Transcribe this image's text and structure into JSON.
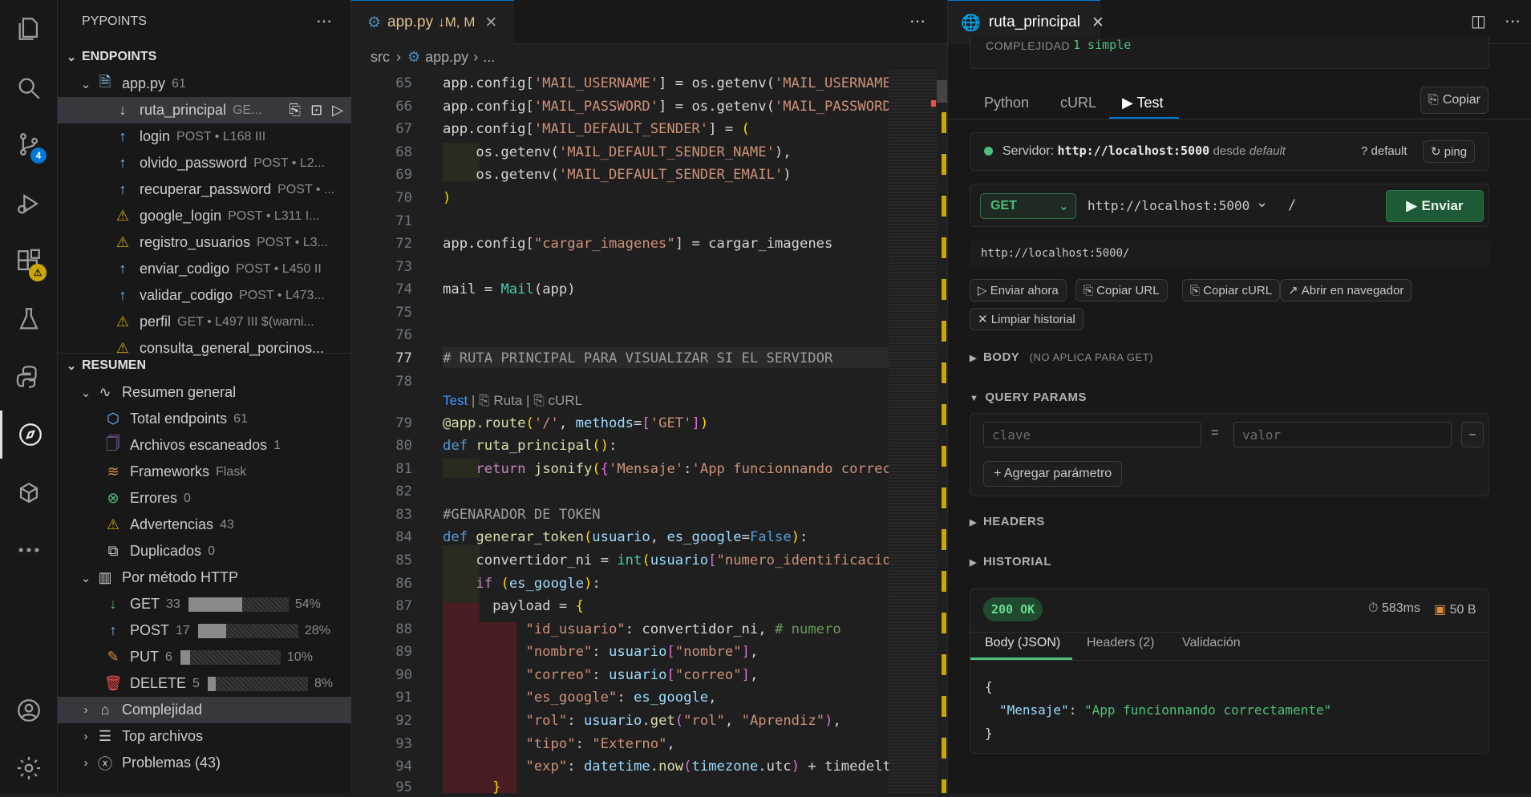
{
  "activity": {
    "scm_badge": "4",
    "warn_badge": "⚠"
  },
  "sidebar": {
    "title": "PYPOINTS",
    "endpoints_header": "ENDPOINTS",
    "file": {
      "name": "app.py",
      "count": "61"
    },
    "endpoints": [
      {
        "name": "ruta_principal",
        "meta": "GE...",
        "kind": "get",
        "selected": true
      },
      {
        "name": "login",
        "meta": "POST • L168 III",
        "kind": "post"
      },
      {
        "name": "olvido_password",
        "meta": "POST • L2...",
        "kind": "post"
      },
      {
        "name": "recuperar_password",
        "meta": "POST • ...",
        "kind": "post"
      },
      {
        "name": "google_login",
        "meta": "POST • L311 I...",
        "kind": "warn"
      },
      {
        "name": "registro_usuarios",
        "meta": "POST • L3...",
        "kind": "warn"
      },
      {
        "name": "enviar_codigo",
        "meta": "POST • L450 II",
        "kind": "post"
      },
      {
        "name": "validar_codigo",
        "meta": "POST • L473...",
        "kind": "post"
      },
      {
        "name": "perfil",
        "meta": "GET • L497 III $(warni...",
        "kind": "warn"
      },
      {
        "name": "consulta_general_porcinos...",
        "meta": "",
        "kind": "warn"
      }
    ],
    "resumen_header": "RESUMEN",
    "resumen": {
      "general_label": "Resumen general",
      "items": [
        {
          "label": "Total endpoints",
          "value": "61",
          "icon": "cube-icon"
        },
        {
          "label": "Archivos escaneados",
          "value": "1",
          "icon": "files-icon"
        },
        {
          "label": "Frameworks",
          "value": "Flask",
          "icon": "layers-icon"
        },
        {
          "label": "Errores",
          "value": "0",
          "icon": "error-icon"
        },
        {
          "label": "Advertencias",
          "value": "43",
          "icon": "warning-icon"
        },
        {
          "label": "Duplicados",
          "value": "0",
          "icon": "copy-icon"
        }
      ],
      "http_label": "Por método HTTP",
      "methods": [
        {
          "label": "GET",
          "count": "33",
          "pct": "54%",
          "fraction": 0.54
        },
        {
          "label": "POST",
          "count": "17",
          "pct": "28%",
          "fraction": 0.28
        },
        {
          "label": "PUT",
          "count": "6",
          "pct": "10%",
          "fraction": 0.1
        },
        {
          "label": "DELETE",
          "count": "5",
          "pct": "8%",
          "fraction": 0.08
        }
      ],
      "complejidad": "Complejidad",
      "top_archivos": "Top archivos",
      "problemas": "Problemas (43)"
    }
  },
  "editor": {
    "tab_name": "app.py",
    "tab_status": "↓M, M",
    "breadcrumb": {
      "folder": "src",
      "file": "app.py",
      "rest": "..."
    },
    "codelens": {
      "test": "Test",
      "ruta": "Ruta",
      "curl": "cURL"
    }
  },
  "panel": {
    "title": "ruta_principal",
    "complejidad": {
      "label": "COMPLEJIDAD",
      "value": "1 simple"
    },
    "tabs": [
      "Python",
      "cURL",
      "Test"
    ],
    "copy_button": "Copiar",
    "server": {
      "label": "Servidor:",
      "url": "http://localhost:5000",
      "from": "desde",
      "source": "default",
      "alias": "? default",
      "ping": "ping"
    },
    "request": {
      "method": "GET",
      "base": "http://localhost:5000",
      "path": "/",
      "send": "Enviar"
    },
    "full_url": "http://localhost:5000/",
    "actions": [
      "Enviar ahora",
      "Copiar URL",
      "Copiar cURL",
      "Abrir en navegador",
      "Limpiar historial"
    ],
    "body": {
      "label": "BODY",
      "note": "(NO APLICA PARA GET)"
    },
    "query": {
      "label": "QUERY PARAMS",
      "key_placeholder": "clave",
      "eq": "=",
      "value_placeholder": "valor",
      "remove": "−",
      "add": "+ Agregar parámetro"
    },
    "headers_label": "HEADERS",
    "historial_label": "HISTORIAL",
    "response": {
      "status": "200 OK",
      "time": "583ms",
      "size": "50 B",
      "tabs": [
        "Body (JSON)",
        "Headers (2)",
        "Validación"
      ],
      "json_open": "{",
      "json_key": "\"Mensaje\"",
      "json_colon": ": ",
      "json_value": "\"App funcionnando correctamente\"",
      "json_close": "}"
    }
  },
  "colors": {
    "accent": "#0078d4",
    "green": "#4ec07a",
    "warning": "#cca700",
    "get_arrow": "#75beff",
    "warn": "#e2c08d"
  }
}
